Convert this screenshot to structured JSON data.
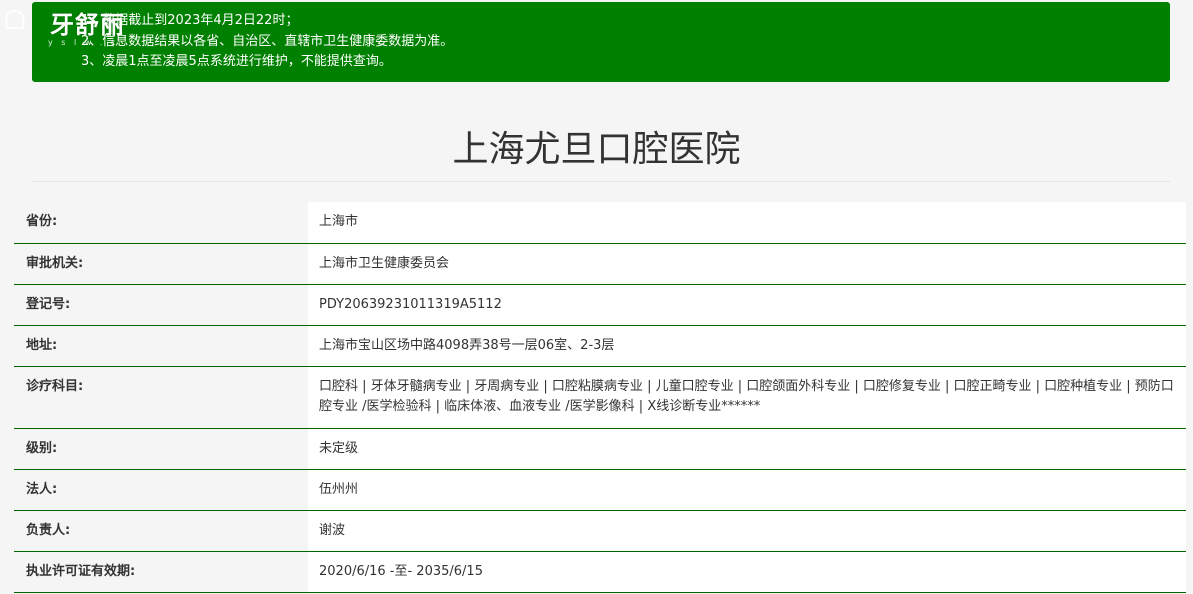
{
  "logo": {
    "name": "牙舒丽",
    "sub": "y s l w . c"
  },
  "notice": {
    "line1": "1、数据截止到2023年4月2日22时；",
    "line2": "2、信息数据结果以各省、自治区、直辖市卫生健康委数据为准。",
    "line3": "3、凌晨1点至凌晨5点系统进行维护，不能提供查询。"
  },
  "page_title": "上海尤旦口腔医院",
  "rows": [
    {
      "label": "省份:",
      "value": "上海市"
    },
    {
      "label": "审批机关:",
      "value": "上海市卫生健康委员会"
    },
    {
      "label": "登记号:",
      "value": "PDY20639231011319A5112"
    },
    {
      "label": "地址:",
      "value": "上海市宝山区场中路4098弄38号一层06室、2-3层"
    },
    {
      "label": "诊疗科目:",
      "value": "口腔科 | 牙体牙髓病专业 | 牙周病专业 | 口腔粘膜病专业 | 儿童口腔专业 | 口腔颌面外科专业 | 口腔修复专业 | 口腔正畸专业 | 口腔种植专业 | 预防口腔专业 /医学检验科 | 临床体液、血液专业 /医学影像科 | X线诊断专业******"
    },
    {
      "label": "级别:",
      "value": "未定级"
    },
    {
      "label": "法人:",
      "value": "伍州州"
    },
    {
      "label": "负责人:",
      "value": "谢波"
    },
    {
      "label": "执业许可证有效期:",
      "value": "2020/6/16 -至- 2035/6/15"
    }
  ],
  "colors": {
    "notice_bg": "#008000",
    "row_border": "#006400",
    "page_bg": "#f5f5f5"
  }
}
